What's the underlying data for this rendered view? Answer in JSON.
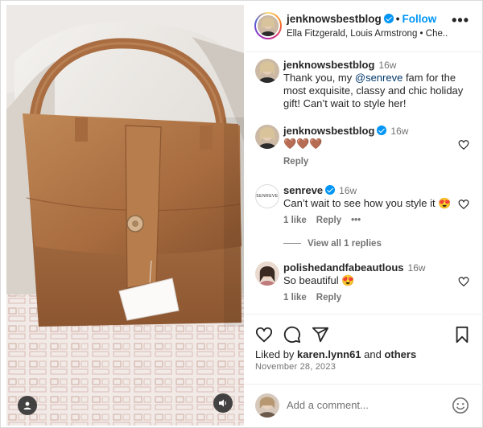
{
  "header": {
    "username": "jenknowsbestblog",
    "follow_label": "Follow",
    "subtitle": "Ella Fitzgerald, Louis Armstrong • Che...",
    "more_label": "•••"
  },
  "caption": {
    "username": "jenknowsbestblog",
    "time": "16w",
    "text_before": "Thank you, my ",
    "mention": "@senreve",
    "text_after": " fam for the most exquisite, classy and chic holiday gift! Can’t wait to style her!"
  },
  "comments": [
    {
      "username": "jenknowsbestblog",
      "time": "16w",
      "text": "🤎🤎🤎",
      "reply_label": "Reply"
    },
    {
      "username": "senreve",
      "time": "16w",
      "text": "Can’t wait to see how you style it 😍",
      "likes_label": "1 like",
      "reply_label": "Reply",
      "more_label": "•••",
      "avatar_text": "SENREVE"
    },
    {
      "username": "polishedandfabeautlous",
      "time": "16w",
      "text": "So beautiful 😍",
      "likes_label": "1 like",
      "reply_label": "Reply"
    }
  ],
  "view_replies_label": "View all 1 replies",
  "likes": {
    "prefix": "Liked by ",
    "user": "karen.lynn61",
    "middle": " and ",
    "suffix": "others"
  },
  "date": "November 28, 2023",
  "add_comment": {
    "placeholder": "Add a comment..."
  },
  "colors": {
    "accent": "#0095f6",
    "leather": "#b57a4e",
    "text": "#262626",
    "muted": "#737373"
  },
  "icons": [
    "heart-icon",
    "comment-icon",
    "share-icon",
    "bookmark-icon",
    "emoji-icon",
    "audio-icon",
    "user-tag-icon",
    "verified-badge-icon"
  ]
}
